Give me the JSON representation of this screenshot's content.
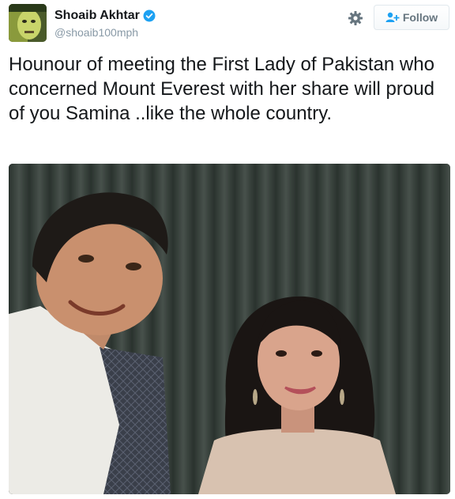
{
  "tweet": {
    "author": {
      "name": "Shoaib Akhtar",
      "handle": "@shoaib100mph",
      "verified": true
    },
    "actions": {
      "settings_icon": "gear-icon",
      "follow_label": "Follow",
      "follow_icon": "add-user-icon"
    },
    "text": "Hounour of meeting the First Lady of Pakistan who concerned Mount Everest with her share will proud  of you Samina ..like the whole country.",
    "colors": {
      "verified_blue": "#1da1f2",
      "text": "#14171a",
      "handle_gray": "#8899a6",
      "button_text": "#66757f"
    }
  }
}
